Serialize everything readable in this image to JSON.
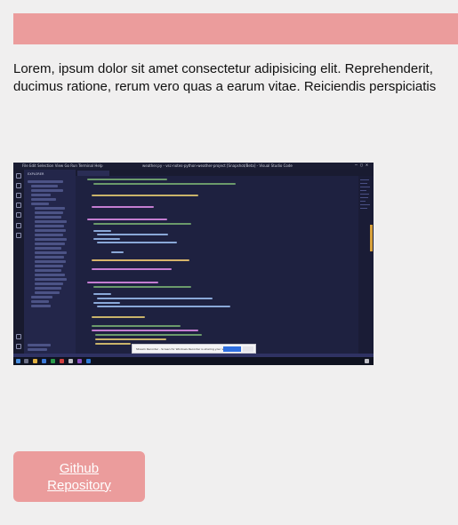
{
  "banner": {
    "color": "#eb9c9c"
  },
  "intro": {
    "line1": "Lorem, ipsum dolor sit amet consectetur adipisicing elit. Reprehenderit,",
    "line2": "ducimus ratione, rerum vero quas a earum vitae. Reiciendis perspiciatis"
  },
  "screenshot": {
    "menu": "File  Edit  Selection  View  Go  Run  Terminal  Help",
    "window_title": "weather.py - vsc-notes-python-weather-project [Snapshot/Beta] - Visual Studio Code",
    "explorer_header": "EXPLORER",
    "toast_message": "Stream Recorder - Screen for Windows Recorder is sharing your screen."
  },
  "link": {
    "label": "Github Repository",
    "color": "#eb9c9c"
  }
}
